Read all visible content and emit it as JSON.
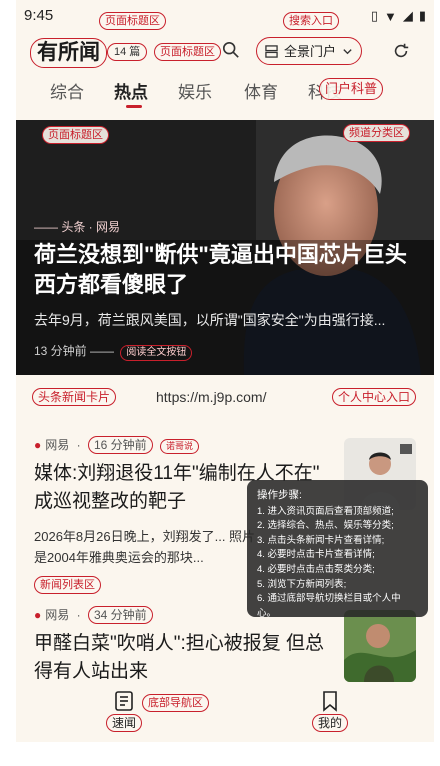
{
  "status_bar": {
    "time": "9:45"
  },
  "annotations": {
    "page_title_area_top": "页面标题区",
    "search_entry": "搜索入口",
    "page_title_area_header": "页面标题区",
    "portal_popular": "门户科普",
    "page_title_area_hero": "页面标题区",
    "channel_category": "频道分类区",
    "headline_card": "头条新闻卡片",
    "personal_center_entry": "个人中心入口",
    "news_list_area": "新闻列表区",
    "bottom_nav_area": "底部导航区",
    "read_full_button": "阅读全文按钮"
  },
  "header": {
    "logo": "有所闻",
    "count_badge": "14 篇",
    "portal_button_label": "全景门户"
  },
  "tabs": [
    {
      "label": "综合",
      "active": false
    },
    {
      "label": "热点",
      "active": true
    },
    {
      "label": "娱乐",
      "active": false
    },
    {
      "label": "体育",
      "active": false
    },
    {
      "label": "科技",
      "active": false
    }
  ],
  "hero": {
    "source": "—— 头条 · 网易",
    "title": "荷兰没想到\"断供\"竟逼出中国芯片巨头 西方都看傻眼了",
    "summary": "去年9月，荷兰跟风美国，以所谓\"国家安全\"为由强行接...",
    "meta": "13 分钟前 ——"
  },
  "url_bar": {
    "url": "https://m.j9p.com/"
  },
  "news_items": [
    {
      "source": "网易",
      "time": "16 分钟前",
      "tag": "诺哥说",
      "title": "媒体:刘翔退役11年\"编制在人不在\" 成巡视整改的靶子",
      "body": "2026年8月26日晚上，刘翔发了... 照片是2004年雅典奥运会的那块..."
    },
    {
      "source": "网易",
      "time": "34 分钟前",
      "title": "甲醛白菜\"吹哨人\":担心被报复 但总得有人站出来"
    }
  ],
  "overlay": {
    "title": "操作步骤:",
    "steps": [
      "1. 进入资讯页面后查看顶部频道;",
      "2. 选择综合、热点、娱乐等分类;",
      "3. 点击头条新闻卡片查看详情;",
      "4. 必要时点击卡片查看详情;",
      "4. 必要时点击点击泵类分类;",
      "5. 浏览下方新闻列表;",
      "6. 通过底部导航切换栏目或个人中心。"
    ]
  },
  "bottom_nav": {
    "left_label": "速闻",
    "right_label": "我的"
  },
  "colors": {
    "accent": "#c8202c",
    "background": "#fbf6ee"
  }
}
